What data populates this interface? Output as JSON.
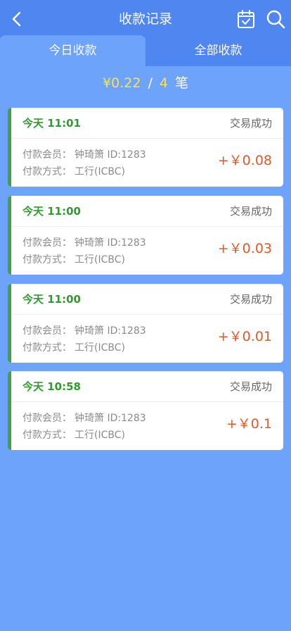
{
  "header": {
    "title": "收款记录"
  },
  "tabs": [
    {
      "label": "今日收款",
      "active": true
    },
    {
      "label": "全部收款",
      "active": false
    }
  ],
  "summary": {
    "amount": "¥0.22",
    "separator": "/",
    "count": "4",
    "unit": "笔"
  },
  "records": [
    {
      "time": "今天 11:01",
      "status": "交易成功",
      "member_label": "付款会员：",
      "member": "钟琦箫 ID:1283",
      "method_label": "付款方式：",
      "method": "工行(ICBC)",
      "amount": "+￥0.08"
    },
    {
      "time": "今天 11:00",
      "status": "交易成功",
      "member_label": "付款会员：",
      "member": "钟琦箫 ID:1283",
      "method_label": "付款方式：",
      "method": "工行(ICBC)",
      "amount": "+￥0.03"
    },
    {
      "time": "今天 11:00",
      "status": "交易成功",
      "member_label": "付款会员：",
      "member": "钟琦箫 ID:1283",
      "method_label": "付款方式：",
      "method": "工行(ICBC)",
      "amount": "+￥0.01"
    },
    {
      "time": "今天 10:58",
      "status": "交易成功",
      "member_label": "付款会员：",
      "member": "钟琦箫 ID:1283",
      "method_label": "付款方式：",
      "method": "工行(ICBC)",
      "amount": "+￥0.1"
    }
  ],
  "colors": {
    "header_bg": "#4f86f0",
    "page_bg": "#6ea3fb",
    "summary_accent": "#ffe14a",
    "time_green": "#2f9a2f",
    "amount_red": "#e05a2c"
  },
  "icons": [
    "back-icon",
    "calendar-icon",
    "search-icon"
  ]
}
